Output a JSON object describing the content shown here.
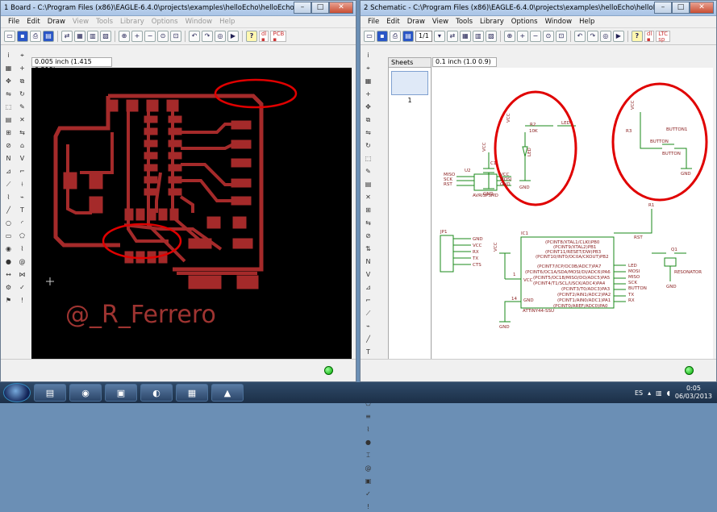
{
  "board_window": {
    "title": "1 Board - C:\\Program Files (x86)\\EAGLE-6.4.0\\projects\\examples\\helloEcho\\helloEcho_Mod_V2.brd - ...",
    "menu": [
      "File",
      "Edit",
      "Draw",
      "View",
      "Tools",
      "Library",
      "Options",
      "Window",
      "Help"
    ],
    "coord": "0.005 inch (1.415 0.215)",
    "watermark": "@_R_Ferrero"
  },
  "schematic_window": {
    "title": "2 Schematic - C:\\Program Files (x86)\\EAGLE-6.4.0\\projects\\examples\\helloEcho\\helloEcho_Mod_V2.s...",
    "menu": [
      "File",
      "Edit",
      "Draw",
      "View",
      "Tools",
      "Library",
      "Options",
      "Window",
      "Help"
    ],
    "sheet_select": "1/1",
    "coord": "0.1 inch (1.0 0.9)",
    "sheets_label": "Sheets",
    "sheet_number": "1",
    "labels": {
      "r2": "R2",
      "r2_val": "10K",
      "led": "LED",
      "led_sym": "LED",
      "vcc1": "VCC",
      "gnd1": "GND",
      "vcc2": "VCC",
      "r3": "R3",
      "button_net": "BUTTON",
      "button1": "BUTTON1",
      "button_name": "BUTTON",
      "gnd2": "GND",
      "vcc3": "VCC",
      "c1": "C1",
      "gnd3": "GND",
      "u2": "U2",
      "miso": "MISO",
      "sck": "SCK",
      "rst": "RST",
      "vcc_u2": "VCC",
      "mosi": "MOSI",
      "gnd_u2": "GND",
      "avrisp": "AVRISPSMD",
      "jp1": "JP1",
      "jp_pins": [
        "GND",
        "VCC",
        "RX",
        "TX",
        "CTS"
      ],
      "ic1": "IC1",
      "ic_vcc": "VCC",
      "ic_gnd": "GND",
      "ic_part": "ATTINY44-SSU",
      "ic_left_pins": [
        "(PCINT8/XTAL1/CLKI)PB0",
        "(PCINT9/XTAL2)PB1",
        "(PCINT11/RESET/DW)PB3",
        "(PCINT10/INT0/OC0A/CKOUT)PB2"
      ],
      "ic_right_pins": [
        "(PCINT7/ICP/OC0B/ADC7)PA7",
        "(PCINT6/OC1A/SDA/MOSI/DI/ADC6)PA6",
        "(PCINT5/OC1B/MISO/DO/ADC5)PA5",
        "(PCINT4/T1/SCL/USCK/ADC4)PA4",
        "(PCINT3/T0/ADC3)PA3",
        "(PCINT2/AIN1/ADC2)PA2",
        "(PCINT1/AIN0/ADC1)PA1",
        "(PCINT0/AREF/ADC0)PA0"
      ],
      "ic_net_right": [
        "LED",
        "MOSI",
        "MISO",
        "SCK",
        "BUTTON",
        "TX",
        "RX"
      ],
      "rst_net": "RST",
      "r1": "R1",
      "q1": "Q1",
      "resonator": "RESONATOR",
      "gnd_res": "GND",
      "gnd_ic": "GND",
      "pin_vcc": "1",
      "pin_gnd": "14"
    }
  },
  "taskbar": {
    "lang": "ES",
    "time": "0:05",
    "date": "06/03/2013",
    "apps": [
      "windows-explorer",
      "chrome",
      "media-center",
      "eagle",
      "pcb",
      "ps"
    ]
  },
  "colors": {
    "pcb_copper": "#a52a2a",
    "annotation_red": "#e00000",
    "watermark": "#9e3431",
    "schematic_green": "#1a8a1a",
    "schematic_text": "#8a2020"
  }
}
